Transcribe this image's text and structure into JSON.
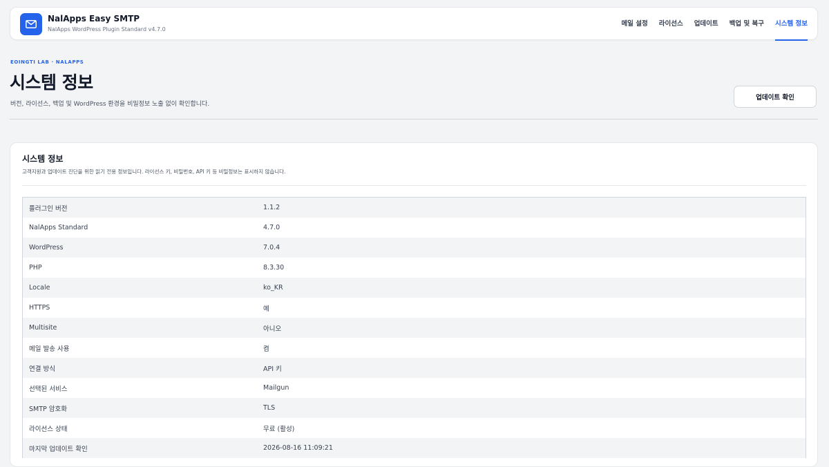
{
  "brand": {
    "title": "NalApps Easy SMTP",
    "subtitle": "NalApps WordPress Plugin Standard v4.7.0",
    "icon": "envelope-icon",
    "accent": "#2563eb"
  },
  "nav": {
    "items": [
      {
        "label": "메일 설정"
      },
      {
        "label": "라이선스"
      },
      {
        "label": "업데이트"
      },
      {
        "label": "백업 및 복구"
      },
      {
        "label": "시스템 정보",
        "active": true
      }
    ]
  },
  "header": {
    "eyebrow": "EOINGTI LAB · NALAPPS",
    "title": "시스템 정보",
    "description": "버전, 라이선스, 백업 및 WordPress 환경을 비밀정보 노출 없이 확인합니다.",
    "check_update_label": "업데이트 확인"
  },
  "card": {
    "title": "시스템 정보",
    "description": "고객지원과 업데이트 진단을 위한 읽기 전용 정보입니다. 라이선스 키, 비밀번호, API 키 등 비밀정보는 표시하지 않습니다.",
    "rows": [
      {
        "key": "플러그인 버전",
        "value": "1.1.2"
      },
      {
        "key": "NalApps Standard",
        "value": "4.7.0"
      },
      {
        "key": "WordPress",
        "value": "7.0.4"
      },
      {
        "key": "PHP",
        "value": "8.3.30"
      },
      {
        "key": "Locale",
        "value": "ko_KR"
      },
      {
        "key": "HTTPS",
        "value": "예"
      },
      {
        "key": "Multisite",
        "value": "아니오"
      },
      {
        "key": "메일 발송 사용",
        "value": "켬"
      },
      {
        "key": "연결 방식",
        "value": "API 키"
      },
      {
        "key": "선택된 서비스",
        "value": "Mailgun"
      },
      {
        "key": "SMTP 암호화",
        "value": "TLS"
      },
      {
        "key": "라이선스 상태",
        "value": "무료 (활성)"
      },
      {
        "key": "마지막 업데이트 확인",
        "value": "2026-08-16 11:09:21"
      }
    ]
  }
}
